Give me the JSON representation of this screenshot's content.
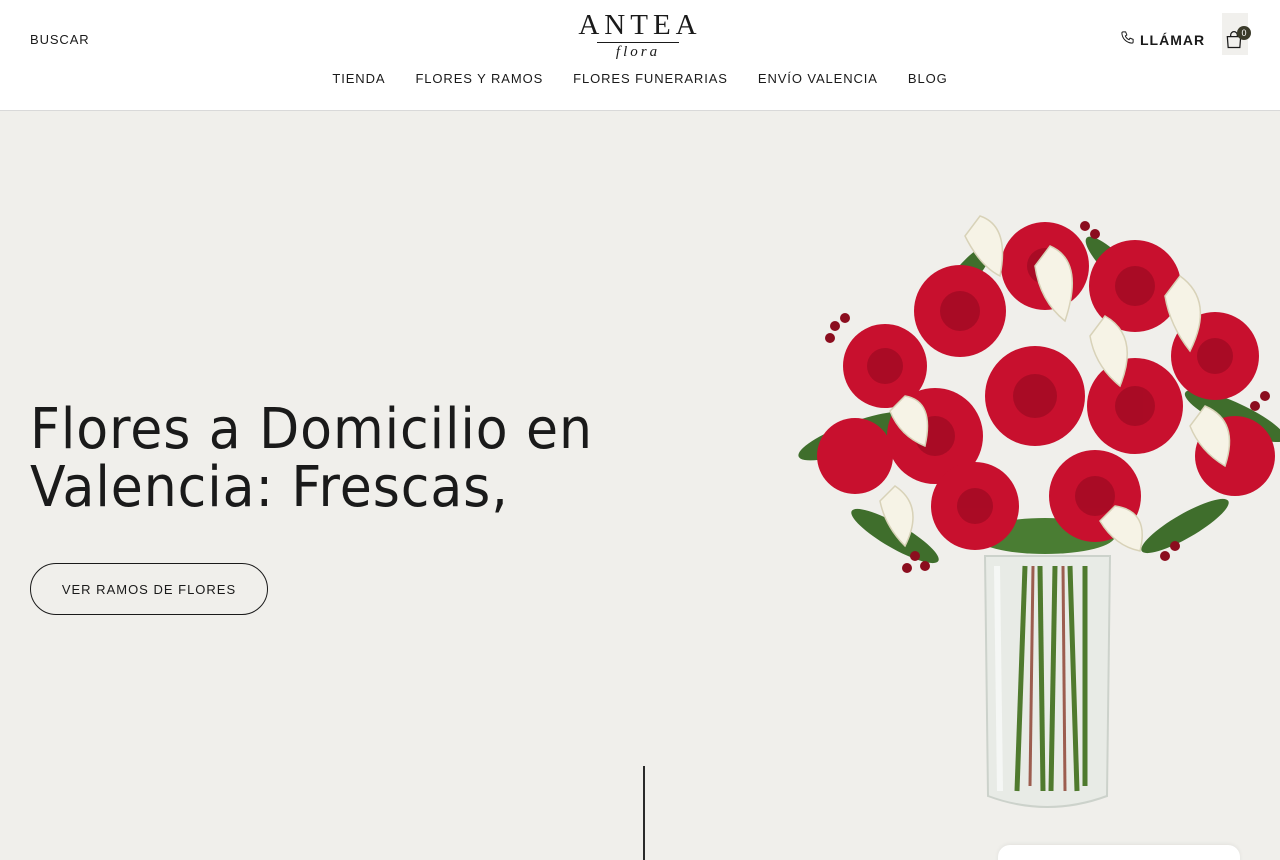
{
  "header": {
    "search_label": "BUSCAR",
    "logo": {
      "main": "ANTEA",
      "sub": "flora"
    },
    "call_label": "LLÁMAR",
    "cart_count": "0"
  },
  "nav": {
    "items": [
      {
        "label": "TIENDA"
      },
      {
        "label": "FLORES Y RAMOS"
      },
      {
        "label": "FLORES FUNERARIAS"
      },
      {
        "label": "ENVÍO VALENCIA"
      },
      {
        "label": "BLOG"
      }
    ]
  },
  "hero": {
    "title": "Flores a Domicilio en Valencia: Frescas,",
    "button_label": "VER RAMOS DE FLORES"
  },
  "colors": {
    "hero_background": "#f0efeb",
    "text": "#1a1a1a",
    "rose_red": "#c8102e",
    "calla_white": "#f6f3e6",
    "leaf_green": "#3f6e2c"
  },
  "icons": [
    "phone-icon",
    "shopping-bag-icon"
  ]
}
